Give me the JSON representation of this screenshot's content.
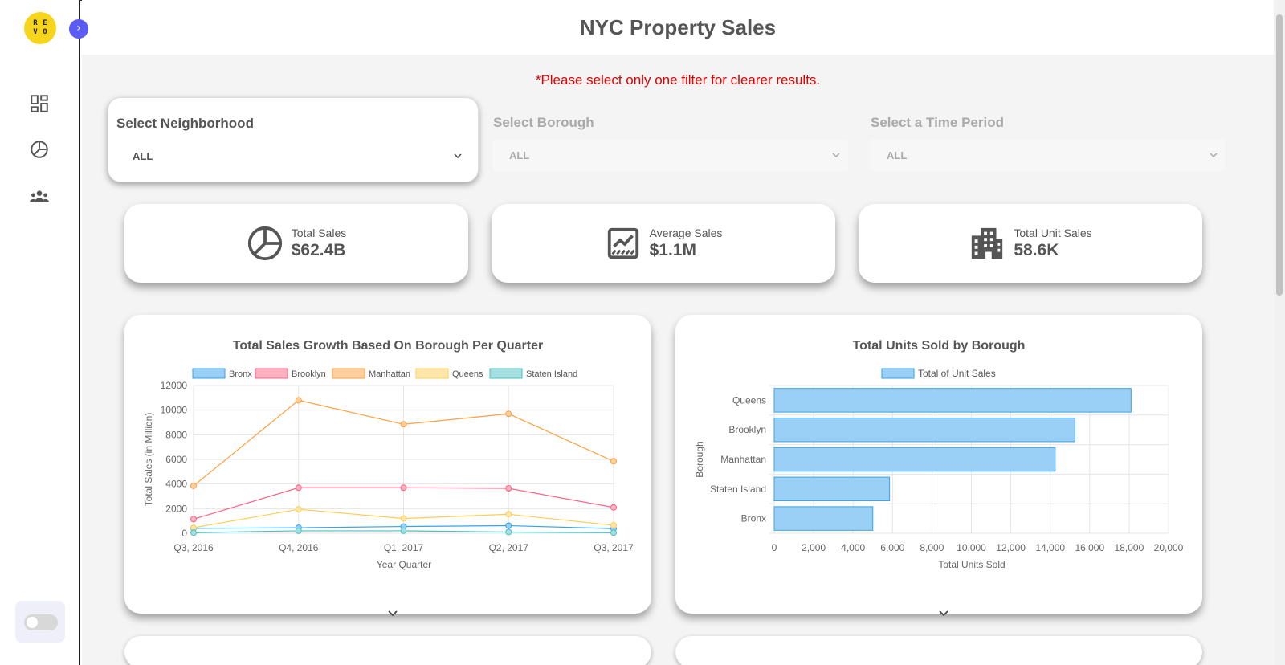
{
  "sidebar": {
    "logo_letters": [
      "R",
      "E",
      "V",
      "O"
    ],
    "expand_icon": "chevron-right-icon",
    "nav_items": [
      {
        "icon": "dashboard-icon"
      },
      {
        "icon": "pie-chart-icon"
      },
      {
        "icon": "team-icon"
      }
    ],
    "theme_toggle": {
      "on": false
    }
  },
  "header": {
    "title": "NYC Property Sales"
  },
  "notice": "*Please select only one filter for clearer results.",
  "filters": [
    {
      "label": "Select Neighborhood",
      "value": "ALL",
      "active": true
    },
    {
      "label": "Select Borough",
      "value": "ALL",
      "active": false
    },
    {
      "label": "Select a Time Period",
      "value": "ALL",
      "active": false
    }
  ],
  "kpis": [
    {
      "label": "Total Sales",
      "value": "$62.4B",
      "icon": "pie-chart-icon"
    },
    {
      "label": "Average Sales",
      "value": "$1.1M",
      "icon": "trend-chart-icon"
    },
    {
      "label": "Total Unit Sales",
      "value": "58.6K",
      "icon": "building-icon"
    }
  ],
  "chart_data": [
    {
      "type": "line",
      "title": "Total Sales Growth Based On Borough Per Quarter",
      "xlabel": "Year Quarter",
      "ylabel": "Total Sales (in Million)",
      "categories": [
        "Q3, 2016",
        "Q4, 2016",
        "Q1, 2017",
        "Q2, 2017",
        "Q3, 2017"
      ],
      "ylim": [
        0,
        12000
      ],
      "yticks": [
        0,
        2000,
        4000,
        6000,
        8000,
        10000,
        12000
      ],
      "legend_position": "top",
      "grid": true,
      "series": [
        {
          "name": "Bronx",
          "color": "#36a2eb",
          "fill": "#9ad0f5",
          "values": [
            400,
            450,
            550,
            620,
            380
          ]
        },
        {
          "name": "Brooklyn",
          "color": "#ff6384",
          "fill": "#ffb1c1",
          "values": [
            1150,
            3700,
            3700,
            3650,
            2100
          ]
        },
        {
          "name": "Manhattan",
          "color": "#ff9f40",
          "fill": "#ffcf9f",
          "values": [
            3850,
            10800,
            8850,
            9700,
            5850
          ]
        },
        {
          "name": "Queens",
          "color": "#ffcd56",
          "fill": "#ffe6aa",
          "values": [
            450,
            1950,
            1200,
            1550,
            650
          ]
        },
        {
          "name": "Staten Island",
          "color": "#4bc0c0",
          "fill": "#a5dfdf",
          "values": [
            50,
            200,
            200,
            100,
            50
          ]
        }
      ]
    },
    {
      "type": "bar",
      "orientation": "horizontal",
      "title": "Total Units Sold by Borough",
      "xlabel": "Total Units Sold",
      "ylabel": "Borough",
      "categories": [
        "Queens",
        "Brooklyn",
        "Manhattan",
        "Staten Island",
        "Bronx"
      ],
      "xlim": [
        0,
        20000
      ],
      "xticks": [
        "0",
        "2,000",
        "4,000",
        "6,000",
        "8,000",
        "10,000",
        "12,000",
        "14,000",
        "16,000",
        "18,000",
        "20,000"
      ],
      "legend_position": "top",
      "grid": true,
      "series": [
        {
          "name": "Total of Unit Sales",
          "color": "#36a2eb",
          "fill": "#9ad0f5",
          "values": [
            18100,
            15250,
            14250,
            5850,
            5000
          ]
        }
      ]
    }
  ]
}
